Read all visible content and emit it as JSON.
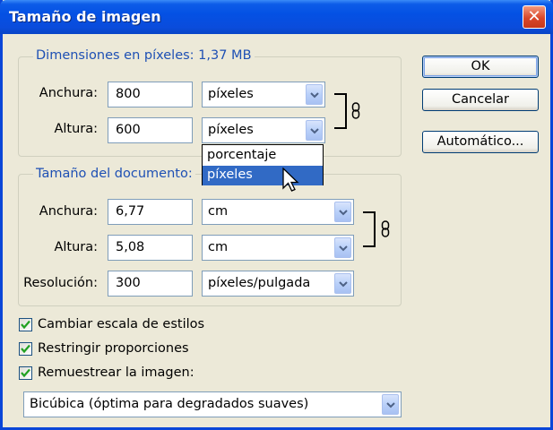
{
  "window": {
    "title": "Tamaño de imagen",
    "close_label": "✕"
  },
  "pixel_dimensions": {
    "legend": "Dimensiones en píxeles: 1,37 MB",
    "width_label": "Anchura:",
    "width_value": "800",
    "width_unit": "píxeles",
    "height_label": "Altura:",
    "height_value": "600",
    "height_unit": "píxeles",
    "unit_options": [
      "porcentaje",
      "píxeles"
    ],
    "selected_option": "píxeles"
  },
  "document_size": {
    "legend": "Tamaño del documento:",
    "width_label": "Anchura:",
    "width_value": "6,77",
    "width_unit": "cm",
    "height_label": "Altura:",
    "height_value": "5,08",
    "height_unit": "cm",
    "resolution_label": "Resolución:",
    "resolution_value": "300",
    "resolution_unit": "píxeles/pulgada"
  },
  "buttons": {
    "ok": "OK",
    "cancel": "Cancelar",
    "auto": "Automático..."
  },
  "options": {
    "scale_styles": {
      "label": "Cambiar escala de estilos",
      "checked": true
    },
    "constrain": {
      "label": "Restringir proporciones",
      "checked": true
    },
    "resample": {
      "label": "Remuestrear la imagen:",
      "checked": true
    }
  },
  "resample_method": "Bicúbica (óptima para degradados suaves)",
  "icons": [
    "close-icon",
    "chain-link-icon",
    "chevron-down-icon",
    "checkmark-icon",
    "mouse-cursor-icon"
  ]
}
